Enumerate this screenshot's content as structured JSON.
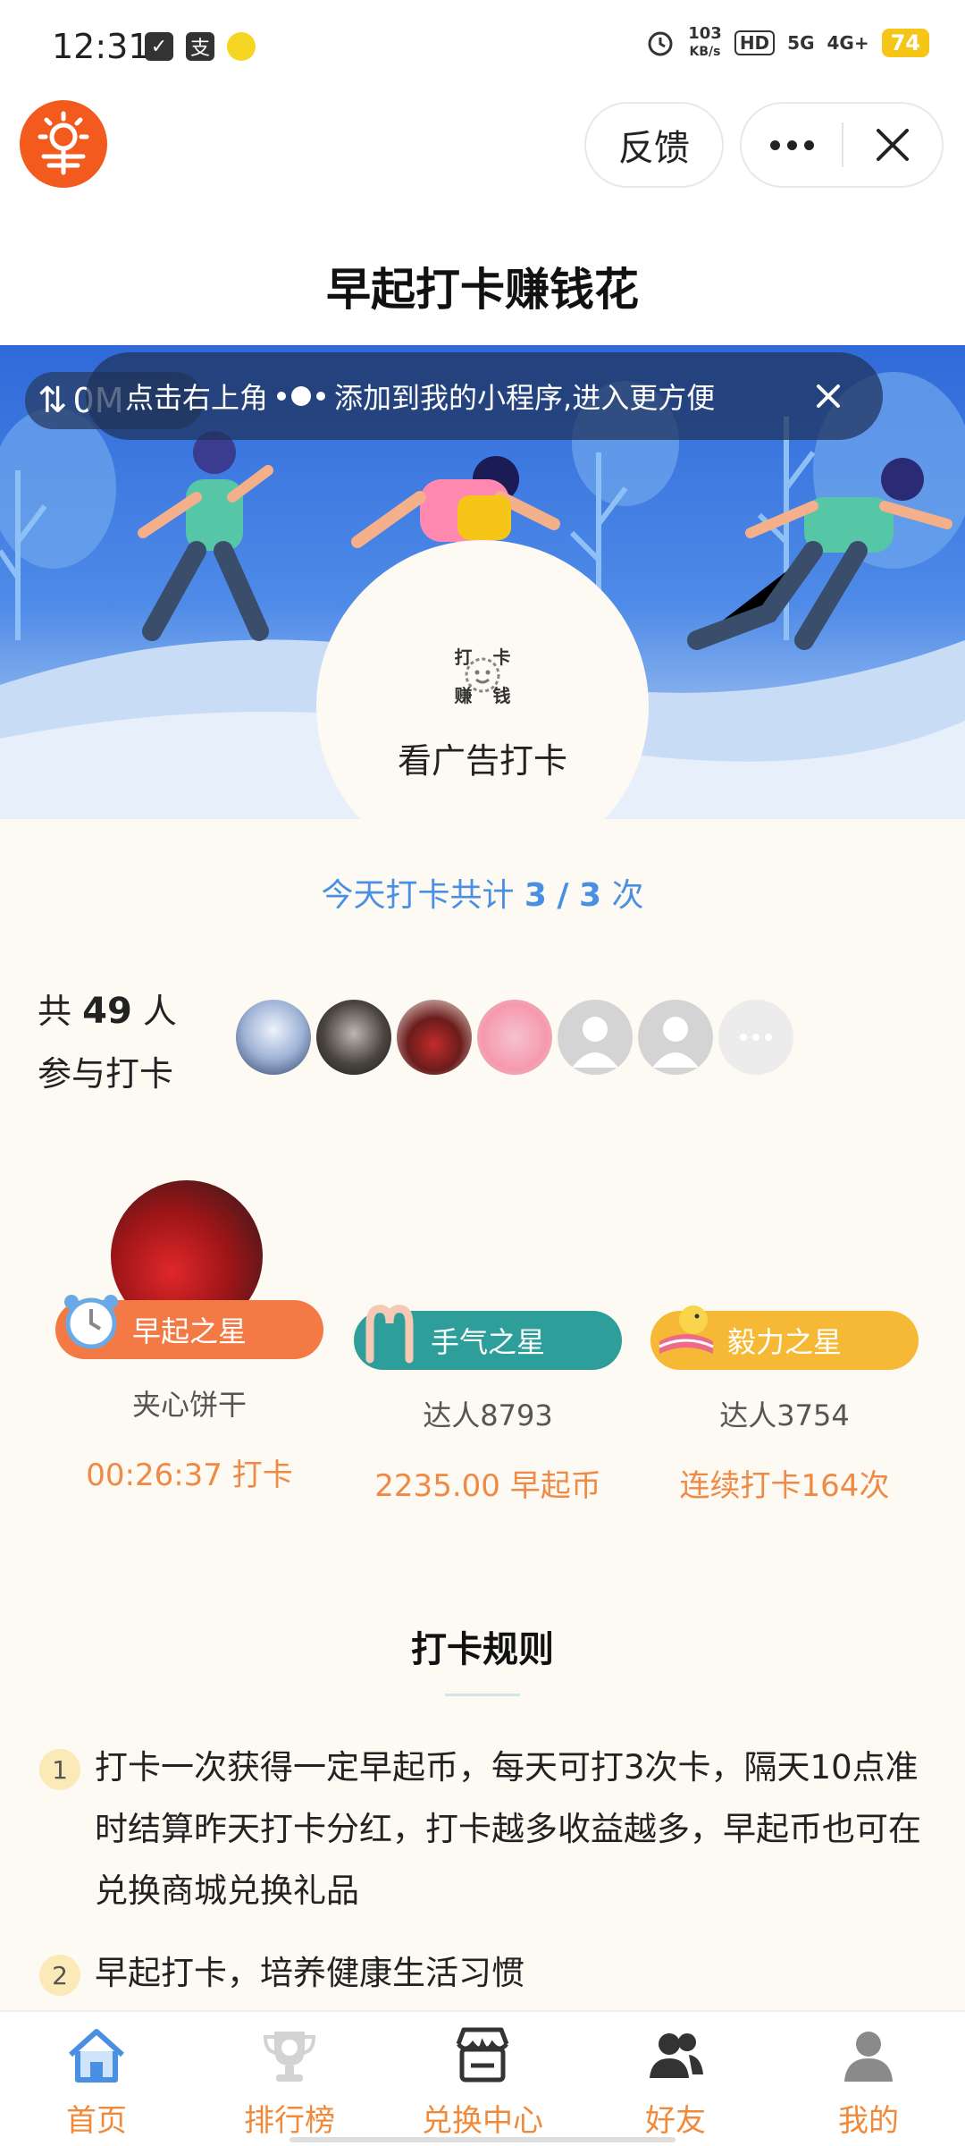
{
  "status_bar": {
    "time": "12:31",
    "left_icons": [
      "shield-icon",
      "alipay-icon",
      "app-icon"
    ],
    "speed_value": "103",
    "speed_unit": "KB/s",
    "hd_badge": "HD",
    "net_5g": "5G",
    "net_4g": "4G+",
    "battery": "74"
  },
  "header": {
    "feedback_label": "反馈",
    "title": "早起打卡赚钱花"
  },
  "banner": {
    "tip_before": "点击右上角",
    "tip_after": "添加到我的小程序,进入更方便",
    "net_speed": "0M",
    "stamp_chars": [
      "打",
      "卡",
      "赚",
      "钱"
    ],
    "checkin_label": "看广告打卡"
  },
  "today": {
    "prefix": "今天打卡共计",
    "done": "3",
    "slash": "/",
    "total": "3",
    "suffix": "次"
  },
  "participants": {
    "prefix": "共",
    "count": "49",
    "suffix": "人",
    "line2": "参与打卡"
  },
  "stars": [
    {
      "title": "早起之星",
      "name": "夹心饼干",
      "value": "00:26:37 打卡",
      "color": "#f47a45"
    },
    {
      "title": "手气之星",
      "name": "达人8793",
      "value": "2235.00 早起币",
      "color": "#2e9e9a"
    },
    {
      "title": "毅力之星",
      "name": "达人3754",
      "value": "连续打卡164次",
      "color": "#f5b935"
    }
  ],
  "rules": {
    "title": "打卡规则",
    "items": [
      {
        "num": "1",
        "text": "打卡一次获得一定早起币，每天可打3次卡，隔天10点准时结算昨天打卡分红，打卡越多收益越多，早起币也可在兑换商城兑换礼品"
      },
      {
        "num": "2",
        "text": "早起打卡，培养健康生活习惯"
      }
    ]
  },
  "tabs": [
    {
      "label": "首页",
      "icon": "home-icon",
      "active": true
    },
    {
      "label": "排行榜",
      "icon": "trophy-icon",
      "active": false
    },
    {
      "label": "兑换中心",
      "icon": "store-icon",
      "active": false
    },
    {
      "label": "好友",
      "icon": "friends-icon",
      "active": false
    },
    {
      "label": "我的",
      "icon": "profile-icon",
      "active": false
    }
  ],
  "colors": {
    "accent_orange": "#f08a3a",
    "accent_blue": "#4a90e2",
    "background": "#fdf9f3"
  }
}
